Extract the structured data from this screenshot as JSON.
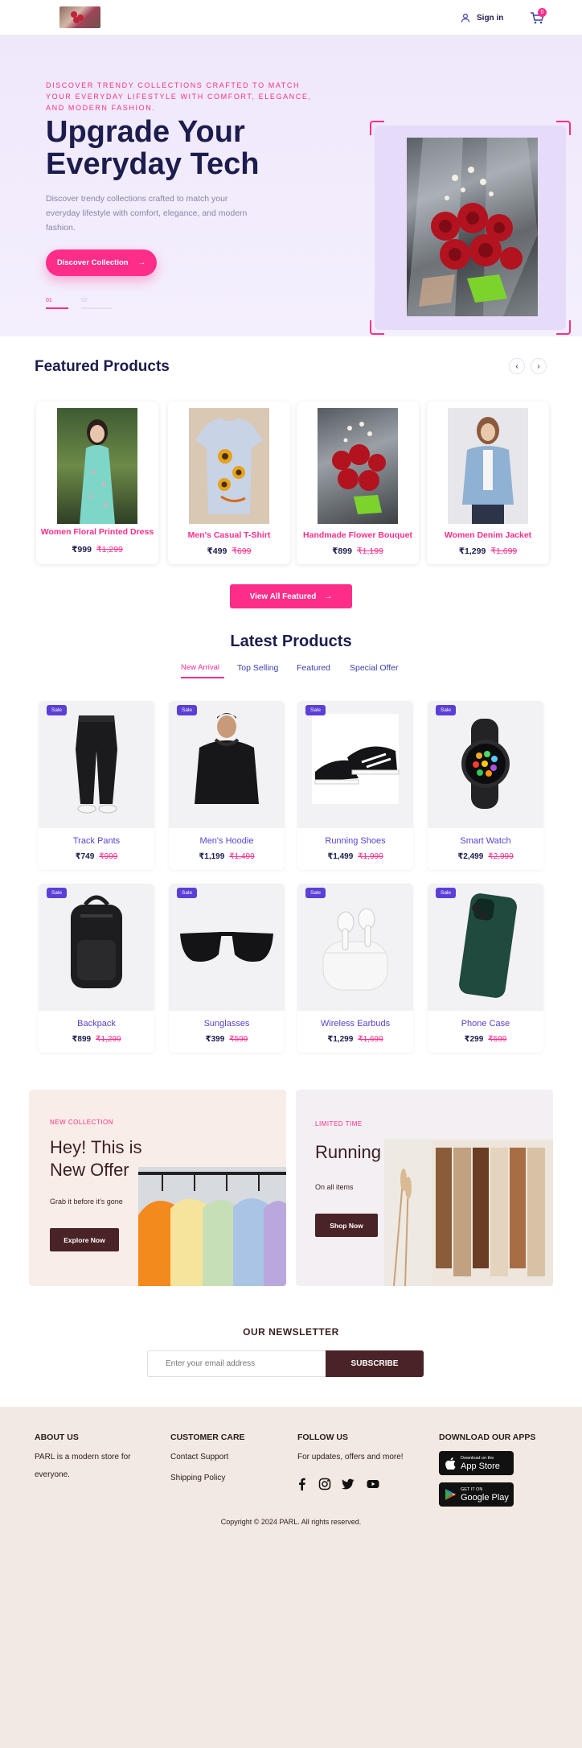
{
  "header": {
    "signin_label": "Sign in",
    "cart_count": "0"
  },
  "hero": {
    "kicker": "Discover trendy collections crafted to match your everyday lifestyle with comfort, elegance, and modern fashion.",
    "title": "Upgrade Your Everyday Tech",
    "description": "Discover trendy collections crafted to match your everyday lifestyle with comfort, elegance, and modern fashion.",
    "button_label": "Discover Collection",
    "slide_current": "01",
    "slide_next": "02",
    "progress": 0.5
  },
  "featured": {
    "title": "Featured Products",
    "items": [
      {
        "name": "Women Floral Printed Dress",
        "price": "₹999",
        "old_price": "₹1,299"
      },
      {
        "name": "Men's Casual T-Shirt",
        "price": "₹499",
        "old_price": "₹699"
      },
      {
        "name": "Handmade Flower Bouquet",
        "price": "₹899",
        "old_price": "₹1,199"
      },
      {
        "name": "Women Denim Jacket",
        "price": "₹1,299",
        "old_price": "₹1,699"
      }
    ],
    "view_all_label": "View All Featured"
  },
  "latest": {
    "title": "Latest Products",
    "tabs": [
      "New Arrival",
      "Top Selling",
      "Featured",
      "Special Offer"
    ],
    "active_tab": "New Arrival",
    "sale_label": "Sale",
    "items": [
      {
        "name": "Track Pants",
        "price": "₹749",
        "old_price": "₹999"
      },
      {
        "name": "Men's Hoodie",
        "price": "₹1,199",
        "old_price": "₹1,499"
      },
      {
        "name": "Running Shoes",
        "price": "₹1,499",
        "old_price": "₹1,999"
      },
      {
        "name": "Smart Watch",
        "price": "₹2,499",
        "old_price": "₹2,999"
      },
      {
        "name": "Backpack",
        "price": "₹899",
        "old_price": "₹1,299"
      },
      {
        "name": "Sunglasses",
        "price": "₹399",
        "old_price": "₹599"
      },
      {
        "name": "Wireless Earbuds",
        "price": "₹1,299",
        "old_price": "₹1,699"
      },
      {
        "name": "Phone Case",
        "price": "₹299",
        "old_price": "₹599"
      }
    ]
  },
  "offers": {
    "left": {
      "kicker": "NEW COLLECTION",
      "title": "Hey! This is New Offer",
      "subtitle": "Grab it before it's gone",
      "button": "Explore Now"
    },
    "right": {
      "kicker": "LIMITED TIME",
      "title": "Running Offers",
      "subtitle": "On all items",
      "button": "Shop Now"
    }
  },
  "newsletter": {
    "title": "OUR NEWSLETTER",
    "placeholder": "Enter your email address",
    "button": "SUBSCRIBE"
  },
  "footer": {
    "about_title": "ABOUT US",
    "about_text": "PARL is a modern store for everyone.",
    "care_title": "CUSTOMER CARE",
    "care_links": [
      "Contact Support",
      "Shipping Policy"
    ],
    "follow_title": "FOLLOW US",
    "follow_text": "For updates, offers and more!",
    "apps_title": "DOWNLOAD OUR APPS",
    "appstore_small": "Download on the",
    "appstore_big": "App Store",
    "googleplay_small": "GET IT ON",
    "googleplay_big": "Google Play",
    "copyright": "Copyright © 2024 PARL. All rights reserved."
  },
  "colors": {
    "accent": "#ff2d8a",
    "navy": "#1c1d4e",
    "purple": "#5b3fd6",
    "brown": "#4a2326"
  }
}
